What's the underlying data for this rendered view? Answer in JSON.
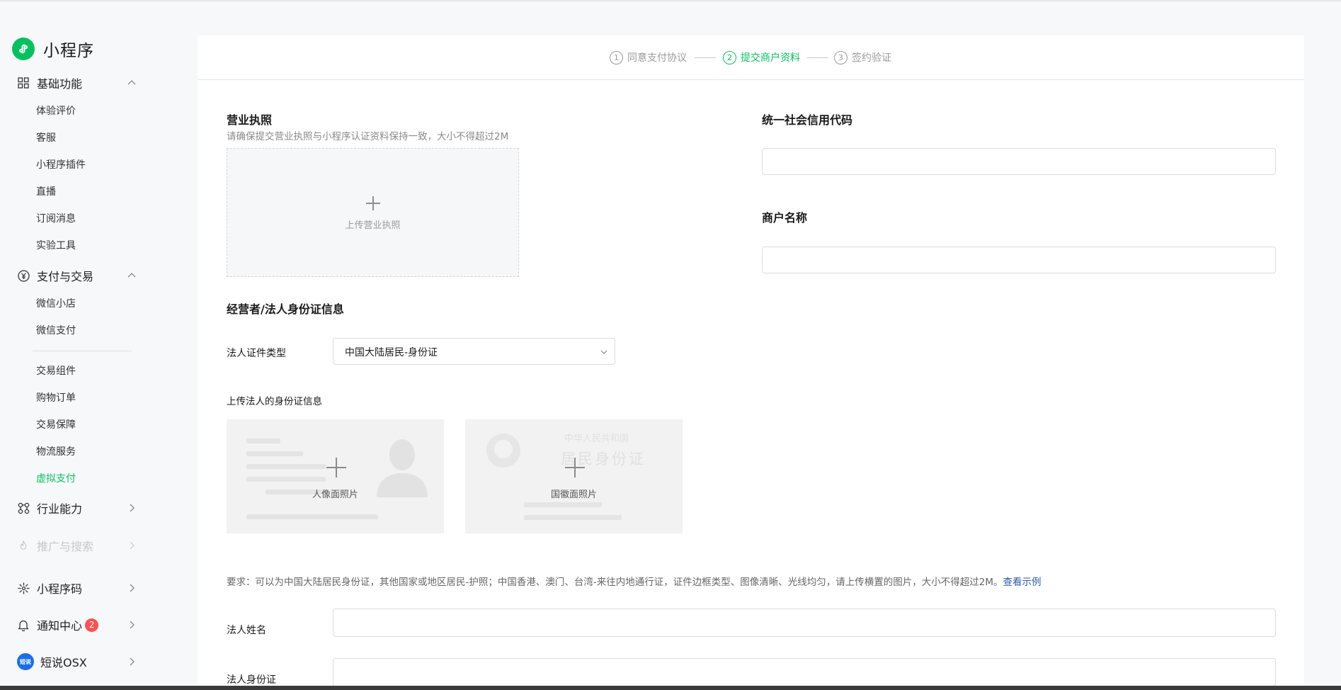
{
  "app": {
    "title": "小程序"
  },
  "sidebar": {
    "groups": [
      {
        "label": "基础功能",
        "expanded": true,
        "items": [
          "体验评价",
          "客服",
          "小程序插件",
          "直播",
          "订阅消息",
          "实验工具"
        ]
      },
      {
        "label": "支付与交易",
        "expanded": true,
        "items": [
          "微信小店",
          "微信支付",
          "交易组件",
          "购物订单",
          "交易保障",
          "物流服务",
          "虚拟支付"
        ],
        "active_item": "虚拟支付"
      },
      {
        "label": "行业能力"
      },
      {
        "label": "推广与搜索",
        "disabled": true
      },
      {
        "label": "小程序码"
      },
      {
        "label": "通知中心",
        "badge": "2"
      },
      {
        "label": "短说OSX",
        "avatar_text": "短说"
      }
    ]
  },
  "steps": [
    {
      "num": "1",
      "label": "同意支付协议"
    },
    {
      "num": "2",
      "label": "提交商户资料",
      "current": true
    },
    {
      "num": "3",
      "label": "签约验证"
    }
  ],
  "license": {
    "title": "营业执照",
    "hint": "请确保提交营业执照与小程序认证资料保持一致，大小不得超过2M",
    "upload_label": "上传营业执照"
  },
  "credit_code": {
    "title": "统一社会信用代码",
    "value": ""
  },
  "merchant_name": {
    "title": "商户名称",
    "value": ""
  },
  "legal_person": {
    "section_title": "经营者/法人身份证信息",
    "id_type_label": "法人证件类型",
    "id_type_value": "中国大陆居民-身份证",
    "upload_title": "上传法人的身份证信息",
    "portrait_label": "人像面照片",
    "emblem_label": "国徽面照片",
    "emblem_card_text": [
      "中华人民共和国",
      "居民身份证"
    ],
    "requirement": "要求：可以为中国大陆居民身份证，其他国家或地区居民-护照；中国香港、澳门、台湾-来往内地通行证，证件边框类型、图像清晰、光线均匀，请上传横置的图片，大小不得超过2M。",
    "example_link": "查看示例",
    "name_label": "法人姓名",
    "name_value": "",
    "idno_label": "法人身份证",
    "idno_value": ""
  },
  "colors": {
    "accent": "#07c160",
    "badge": "#fa5151",
    "link": "#2b5aa8"
  }
}
